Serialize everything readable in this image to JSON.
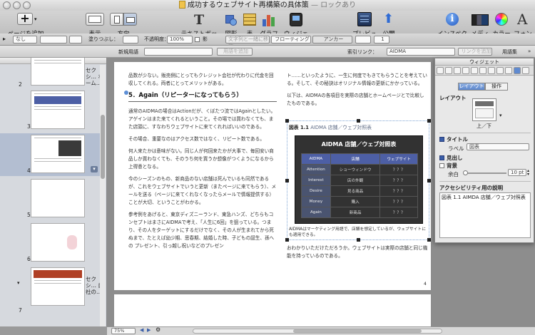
{
  "window": {
    "title": "成功するウェブサイト再構築の具体策",
    "title_suffix": "— ロックあり"
  },
  "toolbar": {
    "add_page": "ページを追加",
    "view": "表示",
    "orientation": "方向",
    "textbox": "テキストボックス",
    "shape": "図形",
    "table": "表",
    "graph": "グラフ",
    "widget": "ウィジェット",
    "preview": "プレビュー",
    "publish": "公開",
    "inspector": "インスペクタ",
    "media": "メディア",
    "color": "カラー",
    "font": "フォント"
  },
  "format_bar": {
    "style": "なし",
    "stroke_label": "塗りつぶし：",
    "opacity_label": "不透明度：",
    "opacity": "100%",
    "shadow_label": "影",
    "wrap_mode": "文字列と一緒に移動",
    "floating": "フローティング",
    "anchor": "アンカー",
    "columns_label": "1"
  },
  "index_bar": {
    "new_term_label": "新規用語",
    "add_term": "用語を追加",
    "index_link_label": "索引リンク：",
    "index_link": "AIDMA",
    "add_link": "リンクを追加",
    "glossary": "用語集"
  },
  "sidebar": {
    "header": "ブック",
    "pages": [
      {
        "num": "2",
        "section": "セクシ… ホーム…"
      },
      {
        "num": "3",
        "section": ""
      },
      {
        "num": "4",
        "section": ""
      },
      {
        "num": "5",
        "section": ""
      },
      {
        "num": "6",
        "section": ""
      },
      {
        "num": "7",
        "section": "セクシ… 自社の…"
      }
    ]
  },
  "page": {
    "left_intro": "品数が少ない。販売側にとってもクレジット会社が代わりに代金を回収してくれる。両者にとってメリットがある。",
    "heading": "5．Again（リピーターになってもらう）",
    "p1": "通常のAIDMAの場合はActionだが、くぼたつ流ではAgainとしたい。アゲインはまた来てくれるということ。その場では買わなくても、また店頭に、すなわちウェブサイトに来てくれればいいのである。",
    "p2": "その場合、重要なのはアクセス数ではなく、リピート数である。",
    "p3": "何人来たかは意味がない。同じ人が何回来たかが大事で、毎回安い商品しか買わなくても、そのうち何を買うか想像がつくようになるから上得意となる。",
    "p4": "今のシーズンのもの、新商品のない店舗は死んでいるも同然であるが、これをウェブサイトでいうと更新（またページに来てもらう）、メールを送る（ページに来てくれなくなったらメールで情報提供する）ことが大切、ということがわかる。",
    "p5": "参考例をあげると、東京ディズニーランド、東急ハンズ、どちらもコンセプトはまさにAIDMAで考え、「人生に6回」を狙っている。つまり、その人をターゲットにするだけでなく、その人が生まれてから死ぬまで、たとえば幼少期、思春期、結婚した時、子どもの誕生、孫への プレゼント、引っ越し祝いなどのプレゼン",
    "right_p1": "ト……といったように、一生に何度でもきてもらうことを考えている。そして、その秘訣はオリジナル情報の更新にかかっている。",
    "right_p2": "以下は、AIDMAの各項目を実際の店舗とホームページとで比較したものである。",
    "fig_caption_num": "図表 1.1",
    "fig_caption": "AIDMA 店舗／ウェブ対照表",
    "fig_note": "AIDMAはマーケティング用語で、店舗を想定しているが、ウェブサイトにも適用できる。",
    "right_p3": "おわかりいただけただろうか。ウェブサイトは実際の店舗と同じ機能を持っているのである。",
    "page_number": "4"
  },
  "chart": {
    "title": "AIDMA 店舗／ウェブ対照表",
    "headers": [
      "AIDMA",
      "店舗",
      "ウェブサイト"
    ],
    "rows": [
      [
        "Attention",
        "ショーウィンドウ",
        "？？？"
      ],
      [
        "Interest",
        "店の外観",
        "？？？"
      ],
      [
        "Desire",
        "見る商品",
        "？？？"
      ],
      [
        "Money",
        "購入",
        "？？？"
      ],
      [
        "Again",
        "新商品",
        "？？？"
      ]
    ]
  },
  "inspector": {
    "title": "ウィジェット",
    "tab_layout": "レイアウト",
    "tab_action": "操作",
    "layout_label": "レイアウト",
    "layout_value": "上／下",
    "title_label": "タイトル",
    "label_label": "ラベル",
    "label_value": "図表",
    "caption_label": "見出し",
    "background_label": "背景",
    "margin_label": "余白",
    "margin_value": "10 pt",
    "access_label": "アクセシビリティ用の説明",
    "access_desc": "図表 1.1 AIMDA 店舗／ウェブ対照表"
  },
  "bottom": {
    "zoom": "75%"
  }
}
